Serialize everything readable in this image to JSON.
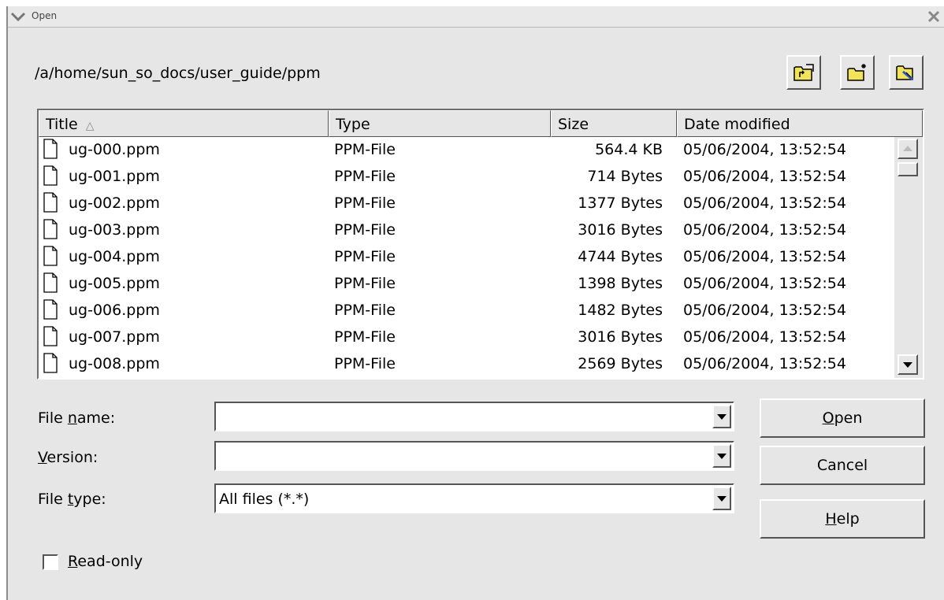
{
  "window": {
    "title": "Open"
  },
  "path": "/a/home/sun_so_docs/user_guide/ppm",
  "toolbar": {
    "up_icon": "folder-up-icon",
    "new_folder_icon": "new-folder-icon",
    "default_dir_icon": "default-directory-icon"
  },
  "columns": [
    "Title",
    "Type",
    "Size",
    "Date modified"
  ],
  "sort_indicator": "△",
  "files": [
    {
      "name": "ug-000.ppm",
      "type": "PPM-File",
      "size": "564.4 KB",
      "date": "05/06/2004, 13:52:54"
    },
    {
      "name": "ug-001.ppm",
      "type": "PPM-File",
      "size": "714 Bytes",
      "date": "05/06/2004, 13:52:54"
    },
    {
      "name": "ug-002.ppm",
      "type": "PPM-File",
      "size": "1377 Bytes",
      "date": "05/06/2004, 13:52:54"
    },
    {
      "name": "ug-003.ppm",
      "type": "PPM-File",
      "size": "3016 Bytes",
      "date": "05/06/2004, 13:52:54"
    },
    {
      "name": "ug-004.ppm",
      "type": "PPM-File",
      "size": "4744 Bytes",
      "date": "05/06/2004, 13:52:54"
    },
    {
      "name": "ug-005.ppm",
      "type": "PPM-File",
      "size": "1398 Bytes",
      "date": "05/06/2004, 13:52:54"
    },
    {
      "name": "ug-006.ppm",
      "type": "PPM-File",
      "size": "1482 Bytes",
      "date": "05/06/2004, 13:52:54"
    },
    {
      "name": "ug-007.ppm",
      "type": "PPM-File",
      "size": "3016 Bytes",
      "date": "05/06/2004, 13:52:54"
    },
    {
      "name": "ug-008.ppm",
      "type": "PPM-File",
      "size": "2569 Bytes",
      "date": "05/06/2004, 13:52:54"
    }
  ],
  "fields": {
    "file_name": {
      "label_pre": "File ",
      "label_key": "n",
      "label_post": "ame:",
      "value": ""
    },
    "version": {
      "label_pre": "",
      "label_key": "V",
      "label_post": "ersion:",
      "value": ""
    },
    "file_type": {
      "label_pre": "File ",
      "label_key": "t",
      "label_post": "ype:",
      "value": "All files (*.*)"
    }
  },
  "buttons": {
    "open": {
      "key": "O",
      "rest": "pen"
    },
    "cancel": {
      "label": "Cancel"
    },
    "help": {
      "key": "H",
      "rest": "elp"
    }
  },
  "readonly": {
    "key": "R",
    "rest": "ead-only",
    "checked": false
  }
}
